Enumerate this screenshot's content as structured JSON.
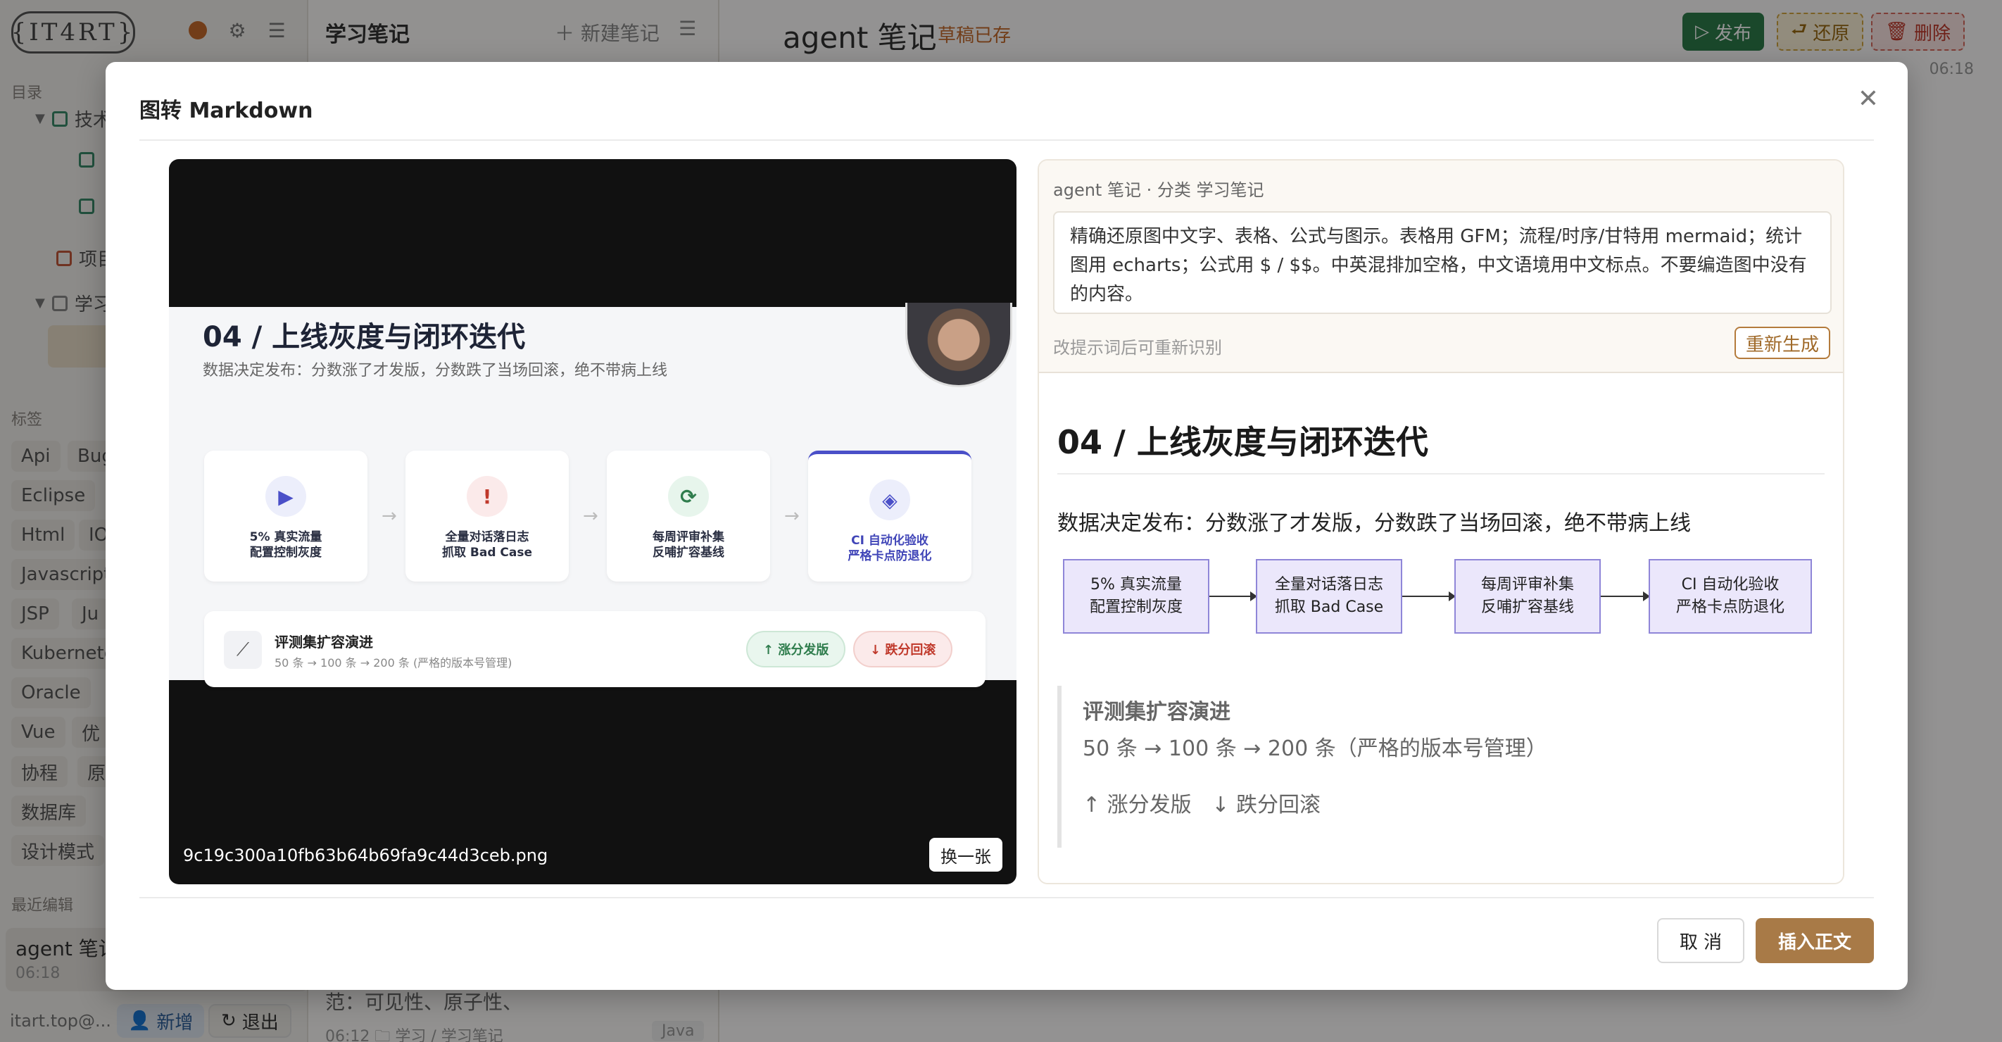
{
  "sidebar": {
    "logo_text": "{IT4RT}",
    "catalog_label": "目录",
    "tree": [
      {
        "label": "技术",
        "icon": "lock-icon"
      },
      {
        "label": "",
        "icon": "lock-icon"
      },
      {
        "label": "",
        "icon": "lock-icon"
      },
      {
        "label": "项目",
        "icon": "lock-icon"
      },
      {
        "label": "学习",
        "icon": "folder-icon"
      }
    ],
    "tags_label": "标签",
    "tags": [
      "Api",
      "Bug",
      "Eclipse",
      "Html",
      "IO",
      "Javascript",
      "JSP",
      "Ju",
      "Kubernetes",
      "Oracle",
      "Vue",
      "优",
      "协程",
      "原",
      "数据库",
      "设计模式"
    ],
    "recent_label": "最近编辑",
    "recent_item": {
      "title": "agent 笔记",
      "time": "06:18"
    },
    "user": "itart.top@...",
    "new_label": "新增",
    "logout_label": "退出"
  },
  "notelist": {
    "title": "学习笔记",
    "new_note": "新建笔记",
    "fragment": "范：可见性、原子性、",
    "meta": "06:12 🗀 学习 / 学习笔记",
    "tag": "Java"
  },
  "editor": {
    "title": "agent 笔记",
    "status": "草稿已存",
    "publish": "发布",
    "restore": "还原",
    "delete": "删除",
    "time": "06:18"
  },
  "modal": {
    "title": "图转 Markdown",
    "preview": {
      "filename": "9c19c300a10fb63b64b69fa9c44d3ceb.png",
      "swap_label": "换一张",
      "slide": {
        "title": "04 / 上线灰度与闭环迭代",
        "subtitle": "数据决定发布：分数涨了才发版，分数跌了当场回滚，绝不带病上线",
        "cards": [
          {
            "l1": "5% 真实流量",
            "l2": "配置控制灰度"
          },
          {
            "l1": "全量对话落日志",
            "l2": "抓取 Bad Case"
          },
          {
            "l1": "每周评审补集",
            "l2": "反哺扩容基线"
          },
          {
            "l1": "CI 自动化验收",
            "l2": "严格卡点防退化"
          }
        ],
        "band_title": "评测集扩容演进",
        "band_sub": "50 条 → 100 条 → 200 条 (严格的版本号管理)",
        "pill_up": "↑ 涨分发版",
        "pill_down": "↓ 跌分回滚"
      }
    },
    "right": {
      "context": "agent 笔记 · 分类 学习笔记",
      "prompt": "精确还原图中文字、表格、公式与图示。表格用 GFM；流程/时序/甘特用 mermaid；统计图用 echarts；公式用 $ / $$。中英混排加空格，中文语境用中文标点。不要编造图中没有的内容。",
      "hint": "改提示词后可重新识别",
      "regen": "重新生成",
      "doc": {
        "h1": "04 / 上线灰度与闭环迭代",
        "p": "数据决定发布：分数涨了才发版，分数跌了当场回滚，绝不带病上线",
        "flow": [
          {
            "l1": "5% 真实流量",
            "l2": "配置控制灰度"
          },
          {
            "l1": "全量对话落日志",
            "l2": "抓取 Bad Case"
          },
          {
            "l1": "每周评审补集",
            "l2": "反哺扩容基线"
          },
          {
            "l1": "CI 自动化验收",
            "l2": "严格卡点防退化"
          }
        ],
        "quote_title": "评测集扩容演进",
        "quote_sub": "50 条 → 100 条 → 200 条（严格的版本号管理）",
        "quote_actions": "↑ 涨分发版   ↓ 跌分回滚"
      }
    },
    "cancel": "取 消",
    "insert": "插入正文"
  }
}
